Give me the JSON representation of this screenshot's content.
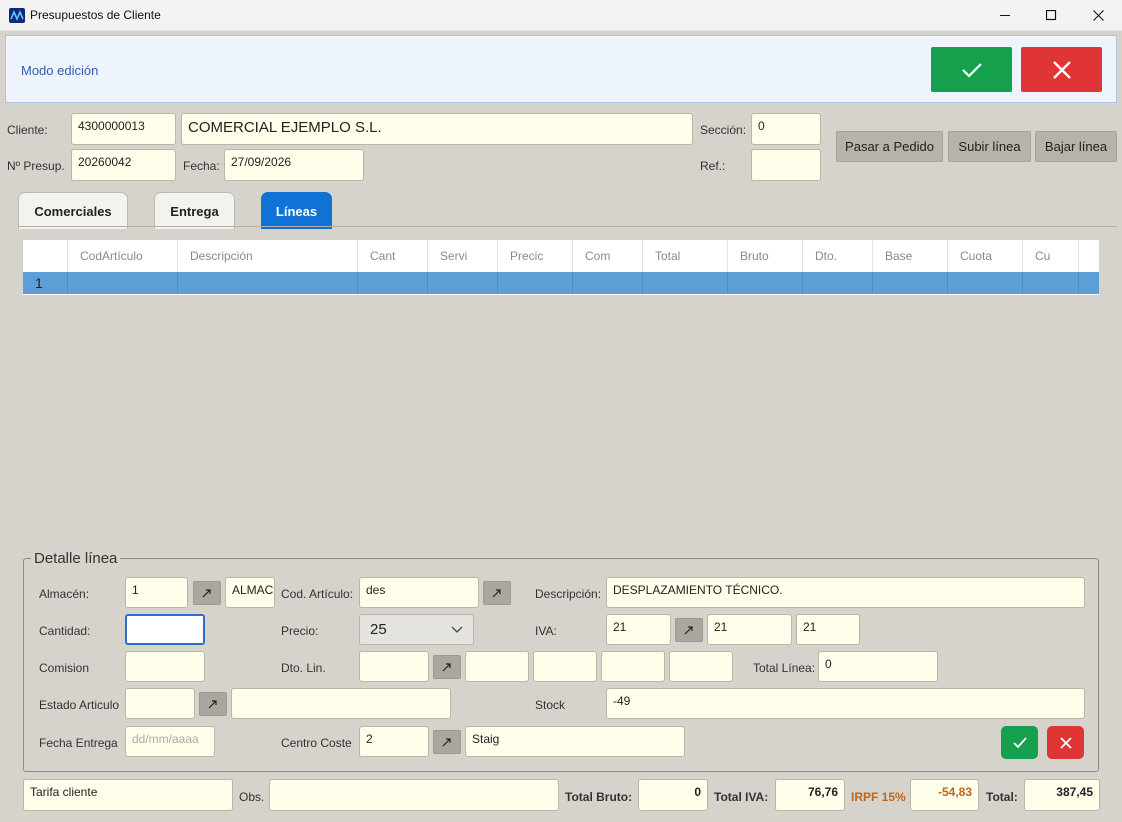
{
  "window": {
    "title": "Presupuestos de Cliente",
    "minimize": "—",
    "maximize": "☐",
    "close": "✕"
  },
  "mode": {
    "text": "Modo edición"
  },
  "header": {
    "cliente_label": "Cliente:",
    "cliente_code": "4300000013",
    "cliente_name": "COMERCIAL EJEMPLO S.L.",
    "seccion_label": "Sección:",
    "seccion_value": "0",
    "presup_label": "Nº Presup.",
    "presup_value": "20260042",
    "fecha_label": "Fecha:",
    "fecha_value": "27/09/2026",
    "ref_label": "Ref.:",
    "ref_value": "",
    "pasar_pedido": "Pasar a Pedido",
    "subir_linea": "Subir línea",
    "bajar_linea": "Bajar línea"
  },
  "tabs": [
    {
      "label": "Comerciales",
      "active": false
    },
    {
      "label": "Entrega",
      "active": false
    },
    {
      "label": "Líneas",
      "active": true
    }
  ],
  "grid": {
    "columns": [
      "",
      "CodArtículo",
      "Descripción",
      "Cant",
      "Servi",
      "Precic",
      "Com",
      "Total",
      "Bruto",
      "Dto.",
      "Base",
      "Cuota",
      "Cu"
    ],
    "rows": [
      {
        "num": "1"
      }
    ]
  },
  "detalle": {
    "title": "Detalle línea",
    "almacen_label": "Almacén:",
    "almacen_code": "1",
    "almacen_name": "ALMACEN",
    "cod_articulo_label": "Cod. Artículo:",
    "cod_articulo_value": "des",
    "descripcion_label": "Descripción:",
    "descripcion_value": "DESPLAZAMIENTO TÉCNICO.",
    "cantidad_label": "Cantidad:",
    "cantidad_value": "",
    "precio_label": "Precio:",
    "precio_value": "25",
    "iva_label": "IVA:",
    "iva_code": "21",
    "iva_value1": "21",
    "iva_value2": "21",
    "comision_label": "Comision",
    "comision_value": "",
    "dto_lin_label": "Dto. Lin.",
    "total_linea_label": "Total Línea:",
    "total_linea_value": "0",
    "estado_label": "Estado Articulo",
    "stock_label": "Stock",
    "stock_value": "-49",
    "fecha_entrega_label": "Fecha Entrega",
    "fecha_entrega_placeholder": "dd/mm/aaaa",
    "centro_coste_label": "Centro Coste",
    "centro_coste_code": "2",
    "centro_coste_name": "Staig"
  },
  "footer": {
    "tarifa": "Tarifa cliente",
    "obs_label": "Obs.",
    "obs_value": "",
    "total_bruto_label": "Total Bruto:",
    "total_bruto_value": "0",
    "total_iva_label": "Total IVA:",
    "total_iva_value": "76,76",
    "irpf_label": "IRPF 15%",
    "irpf_value": "-54,83",
    "total_label": "Total:",
    "total_value": "387,45"
  },
  "colors": {
    "accept": "#16a04e",
    "cancel": "#e03535",
    "tab_active": "#0f72d4",
    "irpf": "#c0651a"
  }
}
